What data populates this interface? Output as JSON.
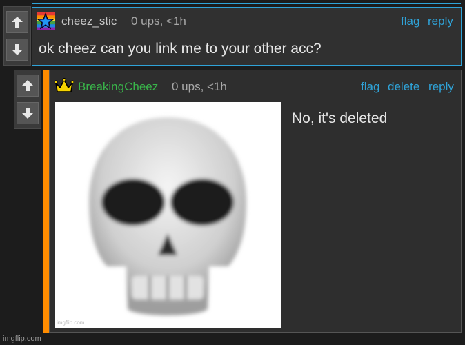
{
  "parent_comment": {
    "username": "cheez_stic",
    "username_color": "#c8c8c8",
    "badge_icon": "rainbow-star-icon",
    "meta": "0 ups, <1h",
    "actions": {
      "flag": "flag",
      "reply": "reply"
    },
    "text": "ok cheez can you link me to your other acc?"
  },
  "reply_comment": {
    "username": "BreakingCheez",
    "username_color": "#39b54a",
    "badge_icon": "crown-icon",
    "meta": "0 ups, <1h",
    "actions": {
      "flag": "flag",
      "delete": "delete",
      "reply": "reply"
    },
    "text": "No, it's deleted",
    "image_icon": "skull-emoji",
    "image_watermark": "imgflip.com"
  },
  "site_watermark": "imgflip.com",
  "colors": {
    "link": "#2fa3d8",
    "accent_bar": "#ff8c00",
    "background": "#1c1c1c",
    "panel": "#303030"
  }
}
